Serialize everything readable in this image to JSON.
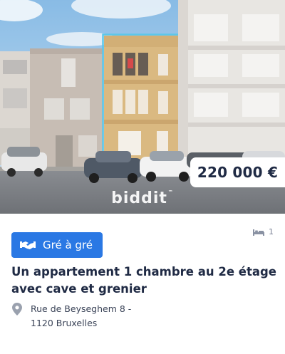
{
  "listing": {
    "price": "220 000 €",
    "watermark": "biddit",
    "watermark_tm": "™",
    "sale_type_label": "Gré à gré",
    "bedrooms": "1",
    "title": "Un appartement 1 chambre au 2e étage avec cave et grenier",
    "address_line1": "Rue de Beyseghem 8 -",
    "address_line2": "1120 Bruxelles"
  },
  "icons": {
    "sale_type": "handshake-icon",
    "bedrooms": "bed-icon",
    "address": "location-pin-icon"
  },
  "colors": {
    "badge": "#2a78e4",
    "title_text": "#1f2a44",
    "building_highlight": "#4fc3e8"
  }
}
